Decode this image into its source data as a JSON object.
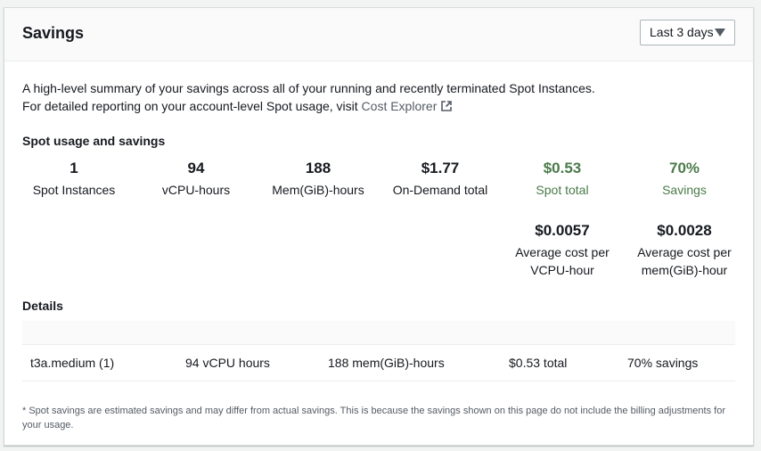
{
  "panel": {
    "title": "Savings",
    "range_select": "Last 3 days"
  },
  "intro": {
    "line1": "A high-level summary of your savings across all of your running and recently terminated Spot Instances.",
    "line2_prefix": "For detailed reporting on your account-level Spot usage, visit ",
    "link_label": "Cost Explorer"
  },
  "usage": {
    "heading": "Spot usage and savings",
    "metrics": [
      {
        "value": "1",
        "label": "Spot Instances"
      },
      {
        "value": "94",
        "label": "vCPU-hours"
      },
      {
        "value": "188",
        "label": "Mem(GiB)-hours"
      },
      {
        "value": "$1.77",
        "label": "On-Demand total"
      },
      {
        "value": "$0.53",
        "label": "Spot total"
      },
      {
        "value": "70%",
        "label": "Savings"
      }
    ],
    "averages": [
      {
        "value": "$0.0057",
        "label_line1": "Average cost per",
        "label_line2": "VCPU-hour"
      },
      {
        "value": "$0.0028",
        "label_line1": "Average cost per",
        "label_line2": "mem(GiB)-hour"
      }
    ],
    "accent_color": "#4a7a4a"
  },
  "details": {
    "heading": "Details",
    "row": {
      "instance": "t3a.medium (1)",
      "vcpu": "94 vCPU hours",
      "mem": "188 mem(GiB)-hours",
      "total": "$0.53 total",
      "savings": "70% savings"
    }
  },
  "footnote": "* Spot savings are estimated savings and may differ from actual savings. This is because the savings shown on this page do not include the billing adjustments for your usage."
}
